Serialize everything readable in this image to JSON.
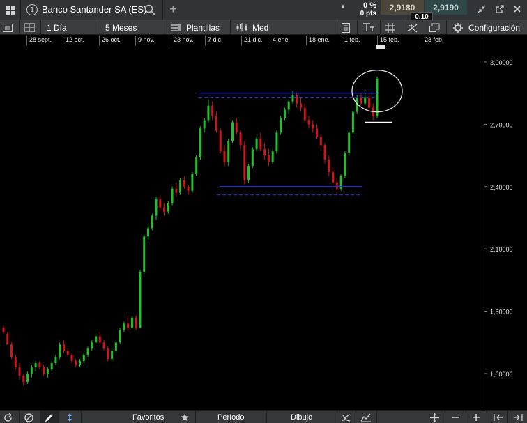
{
  "header": {
    "instrument_number": "1",
    "instrument_name": "Banco Santander SA (ES)",
    "change_pct": "0 %",
    "change_pts": "0 pts",
    "sell_price": "2,9180",
    "buy_price": "2,9190",
    "spread": "0,10",
    "colors": {
      "sell_bg": "#4c463b",
      "buy_bg": "#2e4748"
    }
  },
  "toolbar": {
    "timeframe": "1 Día",
    "range": "5 Meses",
    "templates": "Plantillas",
    "chart_type": "Med",
    "settings": "Configuración"
  },
  "date_axis": [
    "28 sept.",
    "12 oct.",
    "26 oct.",
    "9 nov.",
    "23 nov.",
    "7 dic.",
    "21 dic.",
    "4 ene.",
    "18 ene.",
    "1 feb.",
    "15 feb.",
    "28 feb."
  ],
  "footer": {
    "favorites": "Favoritos",
    "period": "Período",
    "drawing": "Dibujo"
  },
  "chart_data": {
    "type": "candlestick",
    "y_ticks": [
      "3,00000",
      "2,70000",
      "2,40000",
      "2,10000",
      "1,80000",
      "1,50000"
    ],
    "ylim": [
      1.39,
      3.04
    ],
    "colors": {
      "up": "#22c02a",
      "down": "#d0161a",
      "annotation": "#2233dd"
    },
    "candles_ohlc": [
      [
        1.72,
        1.73,
        1.69,
        1.7
      ],
      [
        1.69,
        1.7,
        1.64,
        1.64
      ],
      [
        1.64,
        1.65,
        1.57,
        1.58
      ],
      [
        1.58,
        1.59,
        1.52,
        1.53
      ],
      [
        1.53,
        1.55,
        1.47,
        1.49
      ],
      [
        1.49,
        1.5,
        1.44,
        1.46
      ],
      [
        1.46,
        1.51,
        1.45,
        1.5
      ],
      [
        1.5,
        1.54,
        1.48,
        1.53
      ],
      [
        1.53,
        1.56,
        1.51,
        1.55
      ],
      [
        1.55,
        1.56,
        1.52,
        1.53
      ],
      [
        1.53,
        1.54,
        1.49,
        1.5
      ],
      [
        1.5,
        1.53,
        1.48,
        1.52
      ],
      [
        1.52,
        1.56,
        1.51,
        1.55
      ],
      [
        1.55,
        1.59,
        1.54,
        1.58
      ],
      [
        1.58,
        1.65,
        1.57,
        1.64
      ],
      [
        1.64,
        1.66,
        1.6,
        1.61
      ],
      [
        1.61,
        1.62,
        1.58,
        1.59
      ],
      [
        1.59,
        1.6,
        1.55,
        1.56
      ],
      [
        1.56,
        1.57,
        1.53,
        1.54
      ],
      [
        1.54,
        1.57,
        1.53,
        1.56
      ],
      [
        1.56,
        1.6,
        1.55,
        1.59
      ],
      [
        1.59,
        1.63,
        1.58,
        1.62
      ],
      [
        1.62,
        1.66,
        1.61,
        1.65
      ],
      [
        1.65,
        1.69,
        1.64,
        1.68
      ],
      [
        1.68,
        1.7,
        1.64,
        1.65
      ],
      [
        1.65,
        1.66,
        1.61,
        1.62
      ],
      [
        1.62,
        1.63,
        1.56,
        1.57
      ],
      [
        1.57,
        1.62,
        1.56,
        1.61
      ],
      [
        1.61,
        1.66,
        1.6,
        1.65
      ],
      [
        1.65,
        1.72,
        1.64,
        1.71
      ],
      [
        1.71,
        1.75,
        1.7,
        1.74
      ],
      [
        1.74,
        1.78,
        1.7,
        1.72
      ],
      [
        1.72,
        1.78,
        1.71,
        1.77
      ],
      [
        1.77,
        1.78,
        1.71,
        1.72
      ],
      [
        1.72,
        2.0,
        1.72,
        1.99
      ],
      [
        1.99,
        2.17,
        1.98,
        2.16
      ],
      [
        2.16,
        2.22,
        2.14,
        2.2
      ],
      [
        2.2,
        2.27,
        2.19,
        2.26
      ],
      [
        2.26,
        2.35,
        2.24,
        2.34
      ],
      [
        2.34,
        2.36,
        2.28,
        2.3
      ],
      [
        2.3,
        2.32,
        2.26,
        2.28
      ],
      [
        2.28,
        2.33,
        2.27,
        2.32
      ],
      [
        2.32,
        2.4,
        2.31,
        2.39
      ],
      [
        2.39,
        2.42,
        2.35,
        2.37
      ],
      [
        2.37,
        2.44,
        2.36,
        2.43
      ],
      [
        2.43,
        2.45,
        2.39,
        2.4
      ],
      [
        2.4,
        2.41,
        2.36,
        2.38
      ],
      [
        2.38,
        2.47,
        2.37,
        2.46
      ],
      [
        2.46,
        2.55,
        2.45,
        2.54
      ],
      [
        2.54,
        2.69,
        2.53,
        2.68
      ],
      [
        2.68,
        2.73,
        2.66,
        2.72
      ],
      [
        2.72,
        2.82,
        2.71,
        2.79
      ],
      [
        2.79,
        2.81,
        2.72,
        2.74
      ],
      [
        2.74,
        2.76,
        2.66,
        2.67
      ],
      [
        2.67,
        2.68,
        2.56,
        2.57
      ],
      [
        2.57,
        2.6,
        2.5,
        2.52
      ],
      [
        2.52,
        2.63,
        2.5,
        2.62
      ],
      [
        2.62,
        2.72,
        2.61,
        2.71
      ],
      [
        2.71,
        2.73,
        2.65,
        2.66
      ],
      [
        2.66,
        2.67,
        2.58,
        2.6
      ],
      [
        2.6,
        2.62,
        2.41,
        2.43
      ],
      [
        2.43,
        2.51,
        2.42,
        2.5
      ],
      [
        2.5,
        2.59,
        2.49,
        2.58
      ],
      [
        2.58,
        2.64,
        2.57,
        2.63
      ],
      [
        2.63,
        2.66,
        2.57,
        2.58
      ],
      [
        2.58,
        2.61,
        2.53,
        2.55
      ],
      [
        2.55,
        2.58,
        2.5,
        2.52
      ],
      [
        2.52,
        2.58,
        2.51,
        2.57
      ],
      [
        2.57,
        2.67,
        2.56,
        2.66
      ],
      [
        2.66,
        2.74,
        2.65,
        2.73
      ],
      [
        2.73,
        2.78,
        2.72,
        2.77
      ],
      [
        2.77,
        2.82,
        2.75,
        2.81
      ],
      [
        2.81,
        2.86,
        2.8,
        2.84
      ],
      [
        2.84,
        2.85,
        2.78,
        2.8
      ],
      [
        2.8,
        2.83,
        2.76,
        2.78
      ],
      [
        2.78,
        2.8,
        2.71,
        2.72
      ],
      [
        2.72,
        2.74,
        2.68,
        2.7
      ],
      [
        2.7,
        2.72,
        2.66,
        2.68
      ],
      [
        2.68,
        2.7,
        2.63,
        2.64
      ],
      [
        2.64,
        2.65,
        2.58,
        2.6
      ],
      [
        2.6,
        2.61,
        2.51,
        2.53
      ],
      [
        2.53,
        2.55,
        2.45,
        2.47
      ],
      [
        2.47,
        2.49,
        2.4,
        2.42
      ],
      [
        2.42,
        2.44,
        2.37,
        2.39
      ],
      [
        2.39,
        2.46,
        2.38,
        2.45
      ],
      [
        2.45,
        2.57,
        2.44,
        2.56
      ],
      [
        2.56,
        2.67,
        2.55,
        2.66
      ],
      [
        2.66,
        2.77,
        2.65,
        2.76
      ],
      [
        2.76,
        2.84,
        2.75,
        2.83
      ],
      [
        2.83,
        2.85,
        2.79,
        2.8
      ],
      [
        2.8,
        2.86,
        2.79,
        2.83
      ],
      [
        2.83,
        2.85,
        2.76,
        2.78
      ],
      [
        2.78,
        2.8,
        2.72,
        2.74
      ],
      [
        2.74,
        2.93,
        2.73,
        2.92
      ]
    ],
    "annotations": {
      "resistance_solid": 2.85,
      "resistance_dashed": 2.83,
      "support_solid": 2.4,
      "support_dashed": 2.36,
      "marker_white": 2.71
    }
  }
}
